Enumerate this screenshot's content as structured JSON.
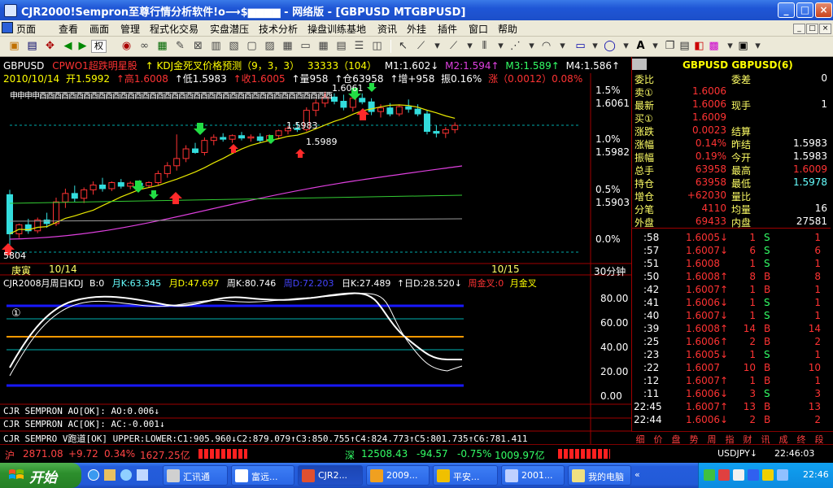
{
  "window": {
    "title": "CJR2000!Sempron至尊行情分析软件!o⟶$▆▆▆▆ - 网络版 - [GBPUSD MTGBPUSD]",
    "btn_min": "_",
    "btn_max": "□",
    "btn_close": "×"
  },
  "menu": [
    "页面",
    "查看",
    "画面",
    "管理",
    "程式化交易",
    "实盘潜压",
    "技术分析",
    "操盘训练基地",
    "资讯",
    "外挂",
    "插件",
    "窗口",
    "帮助"
  ],
  "mdi": {
    "min": "_",
    "restore": "□",
    "close": "×"
  },
  "toolbar": {
    "quan_label": "权"
  },
  "chart": {
    "header_line1": {
      "symbol": "GBPUSD",
      "ind1": "CPWO1超跌明星股",
      "ind2": "↑ KDJ金死叉价格预测（9，3，3）",
      "vol": "33333（104）",
      "m1": "M1:1.602↓",
      "m2": "M2:1.594↑",
      "m3": "M3:1.589↑",
      "m4": "M4:1.586↑"
    },
    "header_line2": {
      "date": "2010/10/14",
      "open": "开1.5992",
      "high": "↑高1.6008",
      "low": "↑低1.5983",
      "close": "↑收1.6005",
      "vol": "↑量958",
      "oi": "↑仓63958",
      "inc": "↑增+958",
      "amp": "振0.16%",
      "chg": "涨（0.0012）0.08%"
    },
    "signal_row": "申申申申酉酉酉酉酉酉酉酉酉酉酉酉酉酉酉酉酉酉酉酉酉酉酉酉酉酉酉酉酉酉酉酉酉酉酉酉酉酉酉酉",
    "price_labels_right": [
      "1.5%",
      "1.6061",
      "1.0%",
      "1.5982",
      "0.5%",
      "1.5903",
      "0.0%"
    ],
    "annotations": {
      "high_mark": "1.6061",
      "mid_mark": "1.5983",
      "mid_mark2": "1.5989",
      "low_mark": "5804"
    },
    "x_labels": {
      "left": "庚寅",
      "d1": "10/14",
      "d2": "10/15",
      "period": "30分钟"
    },
    "sub1_header": {
      "name": "CJR2008月周日KDJ",
      "b": "B:0",
      "yk": "月K:63.345",
      "yd": "月D:47.697",
      "zk": "周K:80.746",
      "zd": "周D:72.203",
      "rk": "日K:27.489",
      "rd": "↑日D:28.520↓",
      "zjc": "周金叉:0",
      "yjc": "月金叉"
    },
    "sub1_axis": [
      "80.00",
      "60.00",
      "40.00",
      "20.00",
      "0.00"
    ],
    "sub1_marker": "①",
    "ao_line": "CJR SEMPRON AO[OK]: AO:0.006↓",
    "ac_line": "CJR SEMPRON  AC[OK]: AC:-0.001↓",
    "v_line": "CJR SEMPRO V跑道[OK]  UPPER:LOWER:C1:905.960↓C2:879.079↑C3:850.755↑C4:824.773↑C5:801.735↑C6:781.411"
  },
  "quote": {
    "title": "GBPUSD GBPUSD(6)",
    "rows": [
      {
        "k": "委比",
        "v": "",
        "k2": "委差",
        "v2": "0"
      },
      {
        "k": "卖①",
        "v": "1.6006",
        "k2": "",
        "v2": ""
      },
      {
        "k": "最新",
        "v": "1.6006",
        "k2": "现手",
        "v2": "1"
      },
      {
        "k": "买①",
        "v": "1.6009",
        "k2": "",
        "v2": ""
      },
      {
        "k": "涨跌",
        "v": "0.0023",
        "k2": "结算",
        "v2": ""
      },
      {
        "k": "涨幅",
        "v": "0.14%",
        "k2": "昨结",
        "v2": "1.5983"
      },
      {
        "k": "振幅",
        "v": "0.19%",
        "k2": "今开",
        "v2": "1.5983"
      },
      {
        "k": "总手",
        "v": "63958",
        "k2": "最高",
        "v2": "1.6009"
      },
      {
        "k": "持仓",
        "v": "63958",
        "k2": "最低",
        "v2": "1.5978"
      },
      {
        "k": "增仓",
        "v": "+62030",
        "k2": "量比",
        "v2": ""
      },
      {
        "k": "分笔",
        "v": "4110",
        "k2": "均量",
        "v2": "16"
      },
      {
        "k": "外盘",
        "v": "69433",
        "k2": "内盘",
        "v2": "27581"
      }
    ],
    "ticks": [
      {
        "t": ":58",
        "p": "1.6005↓",
        "n": "1",
        "s": "S",
        "o": "1"
      },
      {
        "t": ":57",
        "p": "1.6007↓",
        "n": "6",
        "s": "S",
        "o": "6"
      },
      {
        "t": ":51",
        "p": "1.6008",
        "n": "1",
        "s": "S",
        "o": "1"
      },
      {
        "t": ":50",
        "p": "1.6008↑",
        "n": "8",
        "s": "B",
        "o": "8"
      },
      {
        "t": ":42",
        "p": "1.6007↑",
        "n": "1",
        "s": "B",
        "o": "1"
      },
      {
        "t": ":41",
        "p": "1.6006↓",
        "n": "1",
        "s": "S",
        "o": "1"
      },
      {
        "t": ":40",
        "p": "1.6007↓",
        "n": "1",
        "s": "S",
        "o": "1"
      },
      {
        "t": ":39",
        "p": "1.6008↑",
        "n": "14",
        "s": "B",
        "o": "14"
      },
      {
        "t": ":25",
        "p": "1.6006↑",
        "n": "2",
        "s": "B",
        "o": "2"
      },
      {
        "t": ":23",
        "p": "1.6005↓",
        "n": "1",
        "s": "S",
        "o": "1"
      },
      {
        "t": ":22",
        "p": "1.6007",
        "n": "10",
        "s": "B",
        "o": "10"
      },
      {
        "t": ":12",
        "p": "1.6007↑",
        "n": "1",
        "s": "B",
        "o": "1"
      },
      {
        "t": ":11",
        "p": "1.6006↓",
        "n": "3",
        "s": "S",
        "o": "3"
      },
      {
        "t": "22:45",
        "p": "1.6007↑",
        "n": "13",
        "s": "B",
        "o": "13"
      },
      {
        "t": "22:44",
        "p": "1.6006↓",
        "n": "2",
        "s": "B",
        "o": "2"
      }
    ],
    "tabs": [
      "细",
      "价",
      "盘",
      "势",
      "周",
      "指",
      "财",
      "讯",
      "成",
      "终",
      "段"
    ]
  },
  "status": {
    "sh_label": "沪",
    "sh_val": "2871.08",
    "sh_chg": "+9.72",
    "sh_pct": "0.34%",
    "sh_amt": "1627.25亿",
    "sz_label": "深",
    "sz_val": "12508.43",
    "sz_chg": "-94.57",
    "sz_pct": "-0.75%",
    "sz_amt": "1009.97亿",
    "usdjpy": "USDJPY↓",
    "time": "22:46:03"
  },
  "taskbar": {
    "start": "开始",
    "tasks": [
      "汇讯通",
      "富远...",
      "CJR2...",
      "2009...",
      "平安...",
      "2001...",
      "我的电脑"
    ],
    "clock": "22:46"
  },
  "colors": {
    "up": "#ff3333",
    "down": "#33ff66",
    "ma_yellow": "#e8e800",
    "ma_magenta": "#e040e0",
    "ma_green": "#33cc33"
  },
  "candles": [
    {
      "o": 1.589,
      "h": 1.5898,
      "l": 1.5804,
      "c": 1.5825
    },
    {
      "o": 1.5825,
      "h": 1.5842,
      "l": 1.5818,
      "c": 1.584
    },
    {
      "o": 1.584,
      "h": 1.585,
      "l": 1.5825,
      "c": 1.583
    },
    {
      "o": 1.583,
      "h": 1.5852,
      "l": 1.5826,
      "c": 1.5848
    },
    {
      "o": 1.5848,
      "h": 1.586,
      "l": 1.5835,
      "c": 1.5842
    },
    {
      "o": 1.5842,
      "h": 1.5885,
      "l": 1.5838,
      "c": 1.5878
    },
    {
      "o": 1.5878,
      "h": 1.59,
      "l": 1.5868,
      "c": 1.5892
    },
    {
      "o": 1.5892,
      "h": 1.5905,
      "l": 1.5878,
      "c": 1.5884
    },
    {
      "o": 1.5884,
      "h": 1.5902,
      "l": 1.5876,
      "c": 1.5898
    },
    {
      "o": 1.5898,
      "h": 1.5912,
      "l": 1.589,
      "c": 1.5906
    },
    {
      "o": 1.5906,
      "h": 1.5918,
      "l": 1.5895,
      "c": 1.59
    },
    {
      "o": 1.59,
      "h": 1.5912,
      "l": 1.5896,
      "c": 1.591
    },
    {
      "o": 1.591,
      "h": 1.5916,
      "l": 1.59,
      "c": 1.5904
    },
    {
      "o": 1.5904,
      "h": 1.5912,
      "l": 1.5899,
      "c": 1.5909
    },
    {
      "o": 1.5909,
      "h": 1.5914,
      "l": 1.59,
      "c": 1.5905
    },
    {
      "o": 1.5905,
      "h": 1.5912,
      "l": 1.5901,
      "c": 1.591
    },
    {
      "o": 1.591,
      "h": 1.593,
      "l": 1.5906,
      "c": 1.5925
    },
    {
      "o": 1.5925,
      "h": 1.5944,
      "l": 1.5918,
      "c": 1.5938
    },
    {
      "o": 1.5938,
      "h": 1.599,
      "l": 1.593,
      "c": 1.595
    },
    {
      "o": 1.595,
      "h": 1.5972,
      "l": 1.5944,
      "c": 1.5966
    },
    {
      "o": 1.5966,
      "h": 1.5976,
      "l": 1.5958,
      "c": 1.596
    },
    {
      "o": 1.596,
      "h": 1.5985,
      "l": 1.5955,
      "c": 1.598
    },
    {
      "o": 1.598,
      "h": 1.599,
      "l": 1.5972,
      "c": 1.5985
    },
    {
      "o": 1.5985,
      "h": 1.5992,
      "l": 1.5978,
      "c": 1.5982
    },
    {
      "o": 1.5982,
      "h": 1.599,
      "l": 1.5976,
      "c": 1.5988
    },
    {
      "o": 1.5988,
      "h": 1.5994,
      "l": 1.598,
      "c": 1.5984
    },
    {
      "o": 1.5984,
      "h": 1.599,
      "l": 1.5978,
      "c": 1.5986
    },
    {
      "o": 1.5986,
      "h": 1.5992,
      "l": 1.5976,
      "c": 1.598
    },
    {
      "o": 1.598,
      "h": 1.599,
      "l": 1.5975,
      "c": 1.5988
    },
    {
      "o": 1.5988,
      "h": 1.5998,
      "l": 1.5984,
      "c": 1.5996
    },
    {
      "o": 1.5996,
      "h": 1.6004,
      "l": 1.599,
      "c": 1.6
    },
    {
      "o": 1.6,
      "h": 1.601,
      "l": 1.5994,
      "c": 1.5998
    },
    {
      "o": 1.5998,
      "h": 1.6035,
      "l": 1.5995,
      "c": 1.603
    },
    {
      "o": 1.603,
      "h": 1.6048,
      "l": 1.602,
      "c": 1.6042
    },
    {
      "o": 1.6042,
      "h": 1.6061,
      "l": 1.6035,
      "c": 1.6052
    },
    {
      "o": 1.6052,
      "h": 1.6058,
      "l": 1.604,
      "c": 1.6045
    },
    {
      "o": 1.6045,
      "h": 1.6056,
      "l": 1.603,
      "c": 1.6035
    },
    {
      "o": 1.6035,
      "h": 1.6055,
      "l": 1.6028,
      "c": 1.605
    },
    {
      "o": 1.605,
      "h": 1.6058,
      "l": 1.604,
      "c": 1.6044
    },
    {
      "o": 1.6044,
      "h": 1.605,
      "l": 1.6022,
      "c": 1.6028
    },
    {
      "o": 1.6028,
      "h": 1.604,
      "l": 1.6018,
      "c": 1.6034
    },
    {
      "o": 1.6034,
      "h": 1.6042,
      "l": 1.602,
      "c": 1.6024
    },
    {
      "o": 1.6024,
      "h": 1.604,
      "l": 1.602,
      "c": 1.6036
    },
    {
      "o": 1.6036,
      "h": 1.6048,
      "l": 1.6026,
      "c": 1.6032
    },
    {
      "o": 1.6032,
      "h": 1.604,
      "l": 1.602,
      "c": 1.6024
    },
    {
      "o": 1.6024,
      "h": 1.603,
      "l": 1.599,
      "c": 1.5995
    },
    {
      "o": 1.5995,
      "h": 1.6005,
      "l": 1.5985,
      "c": 1.5992
    },
    {
      "o": 1.5992,
      "h": 1.6002,
      "l": 1.5984,
      "c": 1.5998
    },
    {
      "o": 1.5998,
      "h": 1.601,
      "l": 1.5992,
      "c": 1.6005
    }
  ]
}
